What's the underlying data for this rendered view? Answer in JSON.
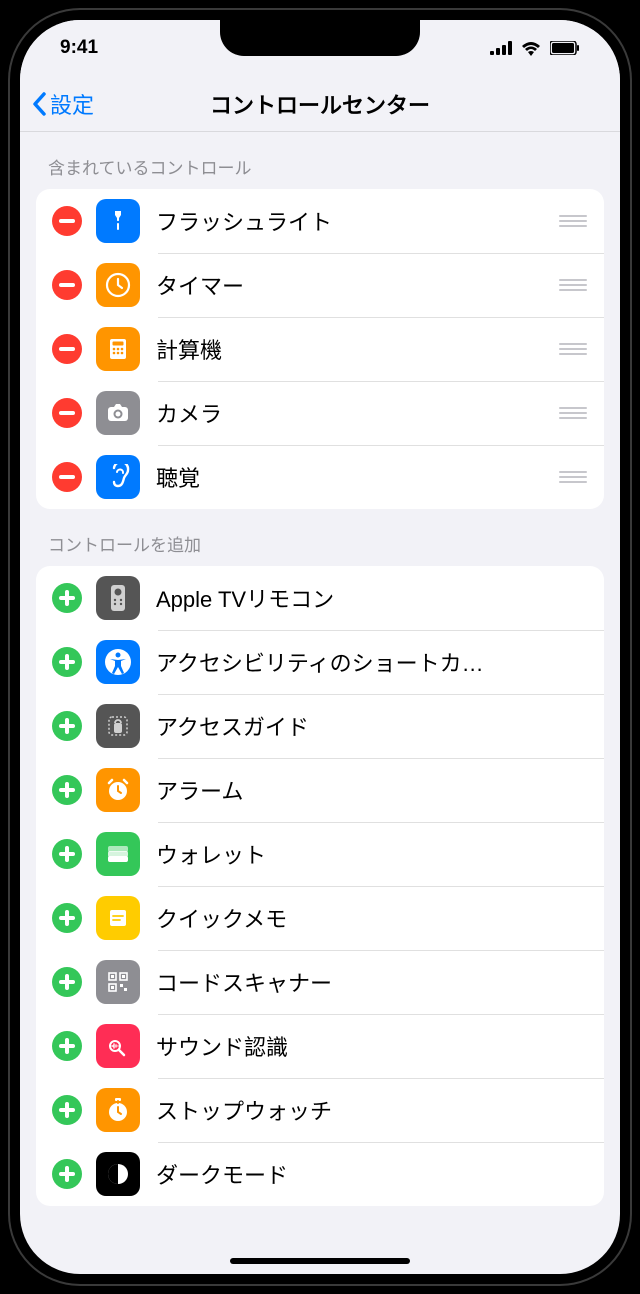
{
  "status": {
    "time": "9:41"
  },
  "nav": {
    "back": "設定",
    "title": "コントロールセンター"
  },
  "sections": {
    "included": {
      "header": "含まれているコントロール",
      "items": [
        {
          "label": "フラッシュライト",
          "iconBg": "#007aff",
          "glyph": "flashlight"
        },
        {
          "label": "タイマー",
          "iconBg": "#ff9500",
          "glyph": "timer"
        },
        {
          "label": "計算機",
          "iconBg": "#ff9500",
          "glyph": "calculator"
        },
        {
          "label": "カメラ",
          "iconBg": "#8e8e93",
          "glyph": "camera"
        },
        {
          "label": "聴覚",
          "iconBg": "#007aff",
          "glyph": "ear"
        }
      ]
    },
    "more": {
      "header": "コントロールを追加",
      "items": [
        {
          "label": "Apple TVリモコン",
          "iconBg": "#555555",
          "glyph": "remote"
        },
        {
          "label": "アクセシビリティのショートカ…",
          "iconBg": "#007aff",
          "glyph": "accessibility"
        },
        {
          "label": "アクセスガイド",
          "iconBg": "#555555",
          "glyph": "guide"
        },
        {
          "label": "アラーム",
          "iconBg": "#ff9500",
          "glyph": "alarm"
        },
        {
          "label": "ウォレット",
          "iconBg": "#34c759",
          "glyph": "wallet"
        },
        {
          "label": "クイックメモ",
          "iconBg": "#ffcc00",
          "glyph": "note"
        },
        {
          "label": "コードスキャナー",
          "iconBg": "#8e8e93",
          "glyph": "qr"
        },
        {
          "label": "サウンド認識",
          "iconBg": "#ff2d55",
          "glyph": "sound"
        },
        {
          "label": "ストップウォッチ",
          "iconBg": "#ff9500",
          "glyph": "stopwatch"
        },
        {
          "label": "ダークモード",
          "iconBg": "#000000",
          "glyph": "dark"
        }
      ]
    }
  }
}
